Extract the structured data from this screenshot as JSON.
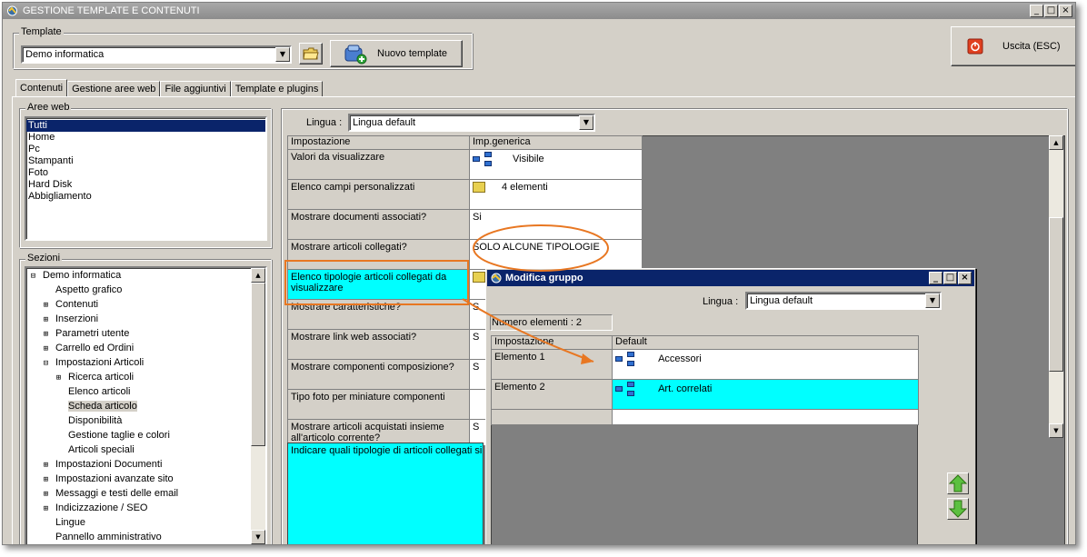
{
  "window": {
    "title": "GESTIONE TEMPLATE E CONTENUTI",
    "min_label": "_",
    "max_label": "□",
    "close_label": "×"
  },
  "template_group": {
    "legend": "Template",
    "selected": "Demo informatica",
    "new_button": "Nuovo template"
  },
  "exit_button": {
    "label": "Uscita (ESC)"
  },
  "tabs": [
    {
      "label": "Contenuti",
      "active": true
    },
    {
      "label": "Gestione aree web",
      "active": false
    },
    {
      "label": "File aggiuntivi",
      "active": false
    },
    {
      "label": "Template e plugins",
      "active": false
    }
  ],
  "aree_web": {
    "legend": "Aree web",
    "items": [
      "Tutti",
      "Home",
      "Pc",
      "Stampanti",
      "Foto",
      "Hard Disk",
      "Abbigliamento"
    ],
    "selected_index": 0
  },
  "sezioni": {
    "legend": "Sezioni",
    "items": [
      {
        "label": "Demo informatica",
        "exp": "⊟",
        "indent": 0
      },
      {
        "label": "Aspetto grafico",
        "exp": "",
        "indent": 1
      },
      {
        "label": "Contenuti",
        "exp": "⊞",
        "indent": 1
      },
      {
        "label": "Inserzioni",
        "exp": "⊞",
        "indent": 1
      },
      {
        "label": "Parametri utente",
        "exp": "⊞",
        "indent": 1
      },
      {
        "label": "Carrello ed Ordini",
        "exp": "⊞",
        "indent": 1
      },
      {
        "label": "Impostazioni Articoli",
        "exp": "⊟",
        "indent": 1
      },
      {
        "label": "Ricerca articoli",
        "exp": "⊞",
        "indent": 2
      },
      {
        "label": "Elenco articoli",
        "exp": "",
        "indent": 2
      },
      {
        "label": "Scheda articolo",
        "exp": "",
        "indent": 2,
        "selected": true
      },
      {
        "label": "Disponibilità",
        "exp": "",
        "indent": 2
      },
      {
        "label": "Gestione taglie e colori",
        "exp": "",
        "indent": 2
      },
      {
        "label": "Articoli speciali",
        "exp": "",
        "indent": 2
      },
      {
        "label": "Impostazioni Documenti",
        "exp": "⊞",
        "indent": 1
      },
      {
        "label": "Impostazioni avanzate sito",
        "exp": "⊞",
        "indent": 1
      },
      {
        "label": "Messaggi e testi delle email",
        "exp": "⊞",
        "indent": 1
      },
      {
        "label": "Indicizzazione / SEO",
        "exp": "⊞",
        "indent": 1
      },
      {
        "label": "Lingue",
        "exp": "",
        "indent": 1
      },
      {
        "label": "Pannello amministrativo",
        "exp": "",
        "indent": 1
      }
    ]
  },
  "main": {
    "lingua_label": "Lingua :",
    "lingua_value": "Lingua default",
    "columns": [
      "Impostazione",
      "Imp.generica"
    ],
    "rows": [
      {
        "label": "Valori da visualizzare",
        "value": "Visibile",
        "icon": "tree-icon"
      },
      {
        "label": "Elenco campi personalizzati",
        "value": "4 elementi",
        "icon": "folder-icon"
      },
      {
        "label": "Mostrare documenti associati?",
        "value": "Si",
        "icon": ""
      },
      {
        "label": "Mostrare articoli collegati?",
        "value": "SOLO ALCUNE TIPOLOGIE",
        "icon": ""
      },
      {
        "label": "Elenco tipologie articoli collegati da visualizzare",
        "value": "",
        "icon": "folder-icon",
        "highlight": true
      },
      {
        "label": "Mostrare caratteristiche?",
        "value": "S",
        "icon": ""
      },
      {
        "label": "Mostrare link web associati?",
        "value": "S",
        "icon": ""
      },
      {
        "label": "Mostrare componenti composizione?",
        "value": "S",
        "icon": ""
      },
      {
        "label": "Tipo foto per miniature componenti",
        "value": "",
        "icon": ""
      },
      {
        "label": "Mostrare articoli acquistati insieme all'articolo corrente?",
        "value": "S",
        "icon": ""
      }
    ],
    "description": "Indicare quali tipologie di articoli collegati si v"
  },
  "dialog": {
    "title": "Modifica gruppo",
    "lingua_label": "Lingua :",
    "lingua_value": "Lingua default",
    "count_label": "Numero elementi : 2",
    "columns": [
      "Impostazione",
      "Default"
    ],
    "rows": [
      {
        "label": "Elemento 1",
        "value": "Accessori"
      },
      {
        "label": "Elemento 2",
        "value": "Art. correlati",
        "highlight": true
      }
    ]
  },
  "colors": {
    "highlight_cyan": "#00ffff",
    "selection_blue": "#0a246a",
    "annotation_orange": "#e87722",
    "button_face": "#d4d0c8"
  }
}
